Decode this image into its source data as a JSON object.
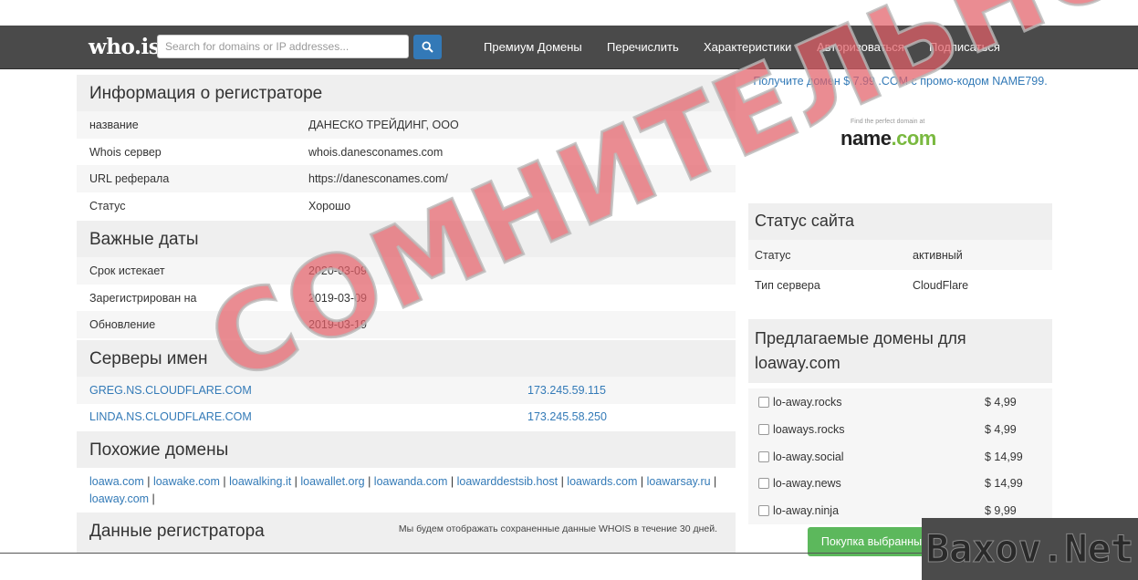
{
  "header": {
    "logo": "who.is",
    "search_placeholder": "Search for domains or IP addresses...",
    "nav": [
      "Премиум Домены",
      "Перечислить",
      "Характеристики",
      "Авторизоваться",
      "Подписаться"
    ]
  },
  "registrar_info": {
    "title": "Информация о регистраторе",
    "rows": [
      {
        "label": "название",
        "value": "ДАНЕСКО ТРЕЙДИНГ, ООО"
      },
      {
        "label": "Whois сервер",
        "value": "whois.danesconames.com"
      },
      {
        "label": "URL реферала",
        "value": "https://danesconames.com/"
      },
      {
        "label": "Статус",
        "value": "Хорошо"
      }
    ]
  },
  "important_dates": {
    "title": "Важные даты",
    "rows": [
      {
        "label": "Срок истекает",
        "value": "2020-03-09"
      },
      {
        "label": "Зарегистрирован на",
        "value": "2019-03-09"
      },
      {
        "label": "Обновление",
        "value": "2019-03-19"
      }
    ]
  },
  "name_servers": {
    "title": "Серверы имен",
    "rows": [
      {
        "host": "GREG.NS.CLOUDFLARE.COM",
        "ip": "173.245.59.115"
      },
      {
        "host": "LINDA.NS.CLOUDFLARE.COM",
        "ip": "173.245.58.250"
      }
    ]
  },
  "similar_domains": {
    "title": "Похожие домены",
    "items": [
      "loawa.com",
      "loawake.com",
      "loawalking.it",
      "loawallet.org",
      "loawanda.com",
      "loawarddestsib.host",
      "loawards.com",
      "loawarsay.ru",
      "loaway.com"
    ]
  },
  "registrar_data": {
    "title": "Данные регистратора",
    "note": "Мы будем отображать сохраненные данные WHOIS в течение 30 дней."
  },
  "sidebar": {
    "promo": "Получите домен $ 7.99 .COM с промо-кодом NAME799.",
    "ad_small": "Find the perfect domain at",
    "ad_brand_a": "name",
    "ad_brand_b": ".com",
    "site_status": {
      "title": "Статус сайта",
      "rows": [
        {
          "label": "Статус",
          "value": "активный"
        },
        {
          "label": "Тип сервера",
          "value": "CloudFlare"
        }
      ]
    },
    "suggested": {
      "title": "Предлагаемые домены для loaway.com",
      "items": [
        {
          "domain": "lo-away.rocks",
          "price": "$ 4,99"
        },
        {
          "domain": "loaways.rocks",
          "price": "$ 4,99"
        },
        {
          "domain": "lo-away.social",
          "price": "$ 14,99"
        },
        {
          "domain": "lo-away.news",
          "price": "$ 14,99"
        },
        {
          "domain": "lo-away.ninja",
          "price": "$ 9,99"
        }
      ],
      "buy_label": "Покупка выбранных доменов"
    }
  },
  "overlay": {
    "stamp": "СОМНИТЕЛЬНО",
    "watermark": "Baxov.Net"
  },
  "colors": {
    "navbar": "#4a4a4a",
    "link": "#337ab7",
    "search_button": "#3379b7",
    "buy_button": "#5cb85c",
    "stamp": "#e26068"
  }
}
